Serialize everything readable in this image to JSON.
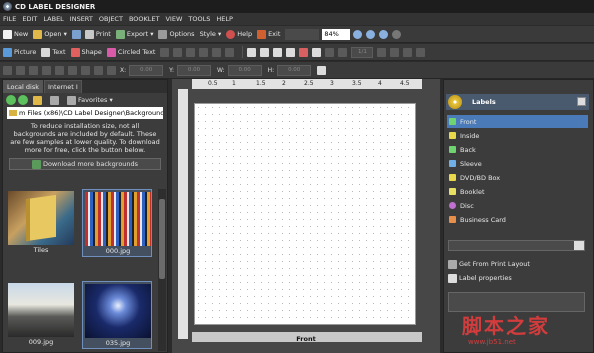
{
  "window": {
    "title": "CD LABEL DESIGNER"
  },
  "menu": [
    "FILE",
    "EDIT",
    "LABEL",
    "INSERT",
    "OBJECT",
    "BOOKLET",
    "VIEW",
    "TOOLS",
    "HELP"
  ],
  "toolbar1": {
    "new": "New",
    "open": "Open",
    "print": "Print",
    "export": "Export",
    "options": "Options",
    "style": "Style",
    "help": "Help",
    "exit": "Exit",
    "zoom": "84%"
  },
  "toolbar2": {
    "picture": "Picture",
    "text": "Text",
    "shape": "Shape",
    "circled_text": "Circled Text",
    "page": "1/1"
  },
  "toolbar3": {
    "x_label": "X:",
    "y_label": "Y:",
    "w_label": "W:",
    "h_label": "H:",
    "x_value": "0.00",
    "y_value": "0.00",
    "w_value": "0.00",
    "h_value": "0.00"
  },
  "left_panel": {
    "tabs": [
      "Local disk",
      "Internet I"
    ],
    "favorites": "Favorites",
    "path": "m Files (x86)\\CD Label Designer\\Backgrounds",
    "info": "To reduce installation size, not all backgrounds are included by default. These are few samples at lower quality. To download more for free, click the button below.",
    "download_button": "Download more backgrounds",
    "thumbs": [
      {
        "caption": "Tiles"
      },
      {
        "caption": "000.jpg"
      },
      {
        "caption": "009.jpg"
      },
      {
        "caption": "035.jpg"
      }
    ]
  },
  "ruler": [
    "0.5",
    "1",
    "1.5",
    "2",
    "2.5",
    "3",
    "3.5",
    "4",
    "4.5"
  ],
  "canvas": {
    "label": "Front"
  },
  "right_panel": {
    "header": "Labels",
    "items": [
      {
        "label": "Front",
        "color": "#6fd46f"
      },
      {
        "label": "Inside",
        "color": "#e8d84a"
      },
      {
        "label": "Back",
        "color": "#6fd46f"
      },
      {
        "label": "Sleeve",
        "color": "#6fb0e8"
      },
      {
        "label": "DVD/BD Box",
        "color": "#e8d84a"
      },
      {
        "label": "Booklet",
        "color": "#e8e060"
      },
      {
        "label": "Disc",
        "color": "#c070d0"
      },
      {
        "label": "Business Card",
        "color": "#e8904a"
      }
    ],
    "get_from_print_layout": "Get From Print Layout",
    "label_properties": "Label properties"
  },
  "watermark": {
    "chars": "脚本之家",
    "url": "www.jb51.net"
  }
}
